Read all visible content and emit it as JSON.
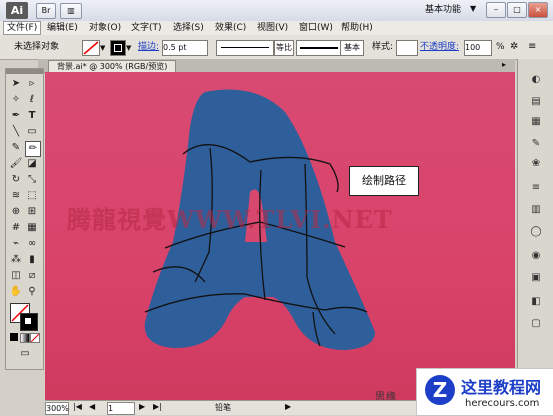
{
  "app": {
    "logo": "Ai",
    "workspace": "基本功能",
    "window_buttons": [
      "–",
      "□",
      "×"
    ]
  },
  "menubar": [
    "文件(F)",
    "编辑(E)",
    "对象(O)",
    "文字(T)",
    "选择(S)",
    "效果(C)",
    "视图(V)",
    "窗口(W)",
    "帮助(H)"
  ],
  "controlbar": {
    "selection_status": "未选择对象",
    "stroke_label": "描边:",
    "stroke_value": "0.5 pt",
    "stroke_profile": "等比",
    "brush": "基本",
    "style_label": "样式:",
    "opacity_label": "不透明度:",
    "opacity_value": "100"
  },
  "document": {
    "tab_label": "背景.ai* @ 300% (RGB/预览)"
  },
  "canvas": {
    "callout": "绘制路径",
    "watermark": "腾龍視覺WWW.TLVI.NET",
    "watermark2": "思缘"
  },
  "statusbar": {
    "zoom": "300%",
    "page": "1",
    "tool": "铅笔"
  },
  "brand": {
    "title": "这里教程网",
    "url": "herecours.com"
  },
  "colors": {
    "canvas_bg": "#d84a72",
    "shape_fill": "#2e5f9a",
    "brand_blue": "#1d3fc7"
  }
}
